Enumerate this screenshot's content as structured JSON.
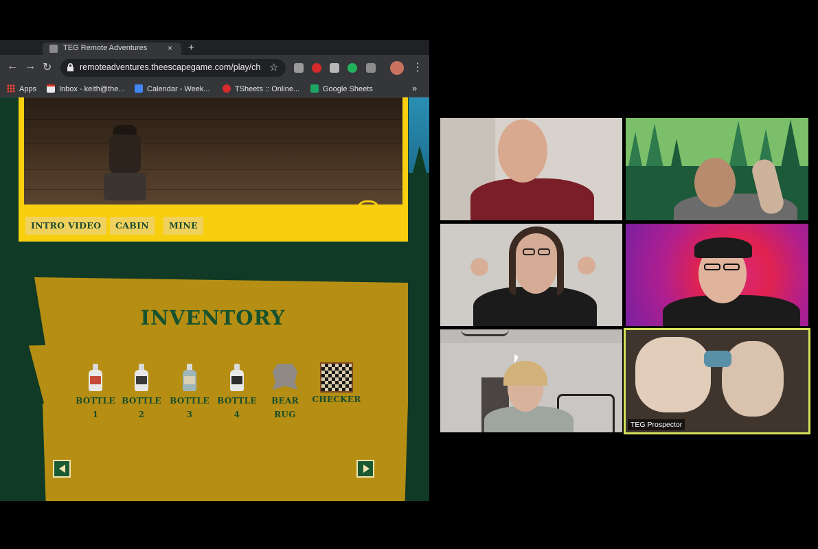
{
  "browser": {
    "tab_title": "TEG Remote Adventures",
    "tab_close": "×",
    "new_tab": "+",
    "url": "remoteadventures.theescapegame.com/play/chi",
    "nav": {
      "back": "←",
      "forward": "→",
      "reload": "↻"
    },
    "star": "☆",
    "menu": "⋮",
    "bookmarks": [
      {
        "label": "Apps"
      },
      {
        "label": "Inbox - keith@the..."
      },
      {
        "label": "Calendar - Week..."
      },
      {
        "label": "TSheets :: Online..."
      },
      {
        "label": "Google Sheets"
      }
    ],
    "bookmarks_overflow": "»"
  },
  "game": {
    "scene_buttons": [
      {
        "label": "INTRO VIDEO"
      },
      {
        "label": "CABIN"
      },
      {
        "label": "MINE"
      }
    ],
    "inventory": {
      "title": "INVENTORY",
      "items": [
        {
          "label": "BOTTLE\n1",
          "icon": "bottle-icon"
        },
        {
          "label": "BOTTLE\n2",
          "icon": "bottle-icon"
        },
        {
          "label": "BOTTLE\n3",
          "icon": "bottle-icon"
        },
        {
          "label": "BOTTLE\n4",
          "icon": "bottle-icon"
        },
        {
          "label": "BEAR\nRUG",
          "icon": "rug-icon"
        },
        {
          "label": "CHECKER",
          "icon": "checker-icon"
        }
      ]
    }
  },
  "call": {
    "active_participant": "TEG Prospector",
    "active_border_color": "#d6e35b"
  },
  "colors": {
    "game_green": "#103a26",
    "frame_yellow": "#f7cf0e",
    "board_gold": "#b58e13"
  }
}
